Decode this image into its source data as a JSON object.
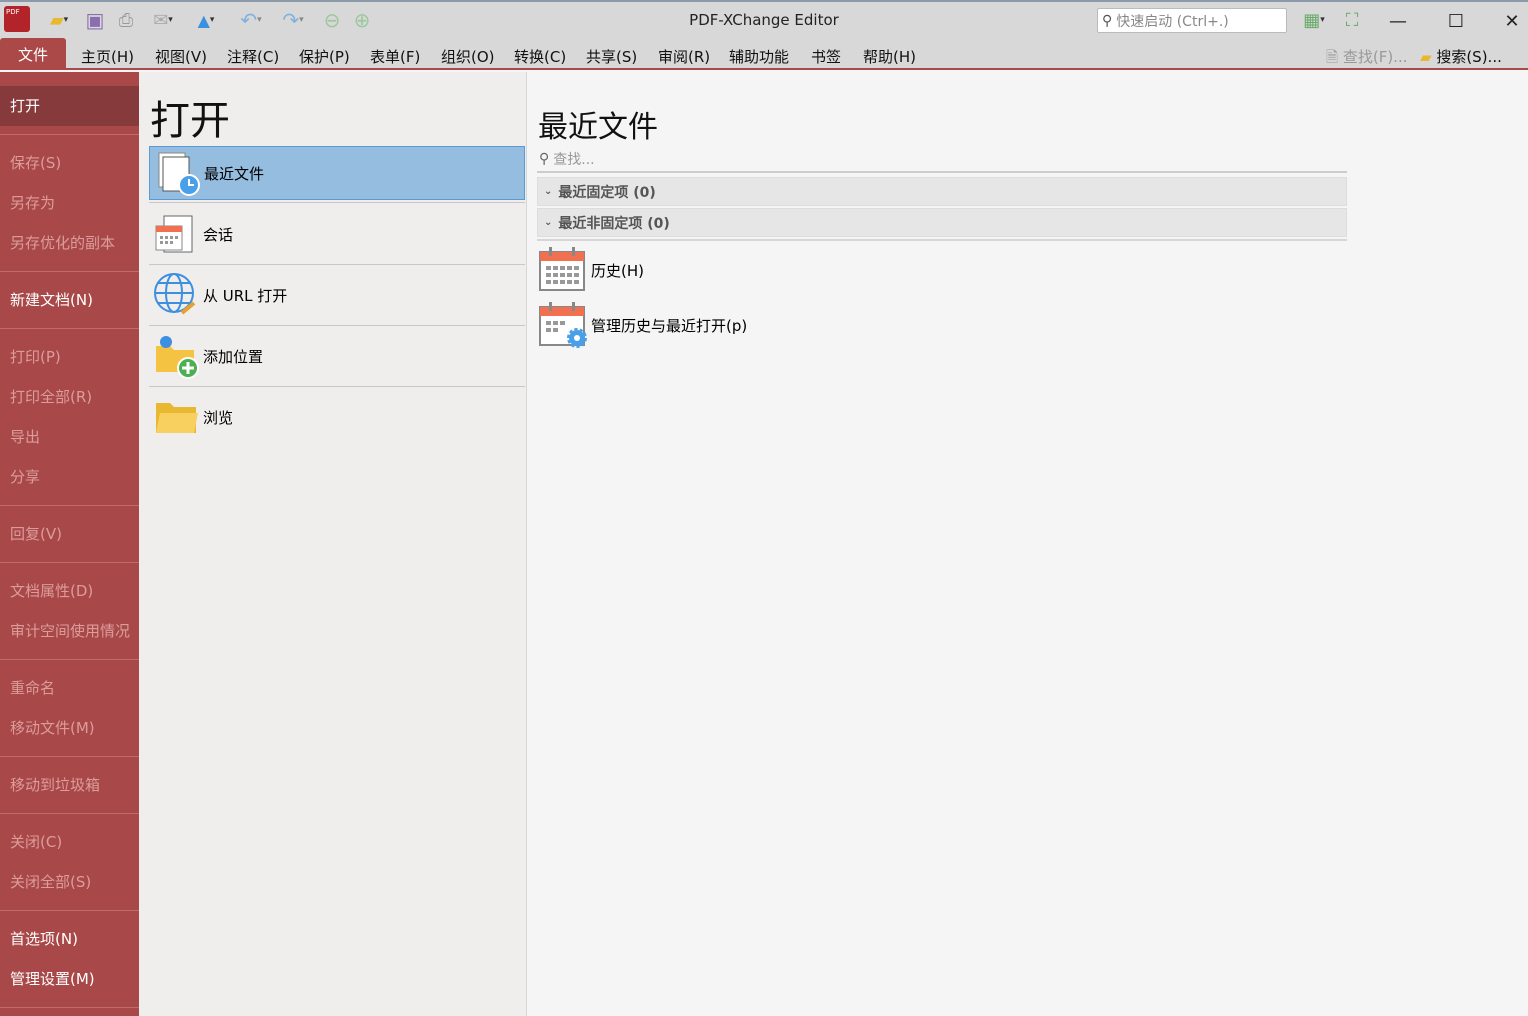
{
  "app": {
    "title": "PDF-XChange Editor",
    "logo_text": "PDF"
  },
  "quick_launch": {
    "placeholder": "快速启动 (Ctrl+.)"
  },
  "menu": {
    "file": "文件",
    "items": [
      "主页(H)",
      "视图(V)",
      "注释(C)",
      "保护(P)",
      "表单(F)",
      "组织(O)",
      "转换(C)",
      "共享(S)",
      "审阅(R)",
      "辅助功能",
      "书签",
      "帮助(H)"
    ],
    "find": "查找(F)...",
    "search": "搜索(S)..."
  },
  "sidebar": {
    "groups": [
      [
        {
          "label": "打开",
          "state": "active"
        }
      ],
      [
        {
          "label": "保存(S)",
          "state": "disabled"
        },
        {
          "label": "另存为",
          "state": "disabled"
        },
        {
          "label": "另存优化的副本",
          "state": "disabled"
        }
      ],
      [
        {
          "label": "新建文档(N)",
          "state": "enabled"
        }
      ],
      [
        {
          "label": "打印(P)",
          "state": "disabled"
        },
        {
          "label": "打印全部(R)",
          "state": "disabled"
        },
        {
          "label": "导出",
          "state": "disabled"
        },
        {
          "label": "分享",
          "state": "disabled"
        }
      ],
      [
        {
          "label": "回复(V)",
          "state": "disabled"
        }
      ],
      [
        {
          "label": "文档属性(D)",
          "state": "disabled"
        },
        {
          "label": "审计空间使用情况",
          "state": "disabled"
        }
      ],
      [
        {
          "label": "重命名",
          "state": "disabled"
        },
        {
          "label": "移动文件(M)",
          "state": "disabled"
        }
      ],
      [
        {
          "label": "移动到垃圾箱",
          "state": "disabled"
        }
      ],
      [
        {
          "label": "关闭(C)",
          "state": "disabled"
        },
        {
          "label": "关闭全部(S)",
          "state": "disabled"
        }
      ],
      [
        {
          "label": "首选项(N)",
          "state": "enabled"
        },
        {
          "label": "管理设置(M)",
          "state": "enabled"
        }
      ]
    ]
  },
  "open_panel": {
    "title": "打开",
    "items": [
      {
        "label": "最近文件",
        "icon": "recent-files-icon"
      },
      {
        "label": "会话",
        "icon": "session-icon"
      },
      {
        "label": "从 URL 打开",
        "icon": "globe-link-icon"
      },
      {
        "label": "添加位置",
        "icon": "add-location-icon"
      },
      {
        "label": "浏览",
        "icon": "folder-icon"
      }
    ]
  },
  "recent": {
    "title": "最近文件",
    "search_placeholder": "查找...",
    "sections": [
      "最近固定项 (0)",
      "最近非固定项 (0)"
    ],
    "actions": [
      "历史(H)",
      "管理历史与最近打开(p)"
    ]
  }
}
